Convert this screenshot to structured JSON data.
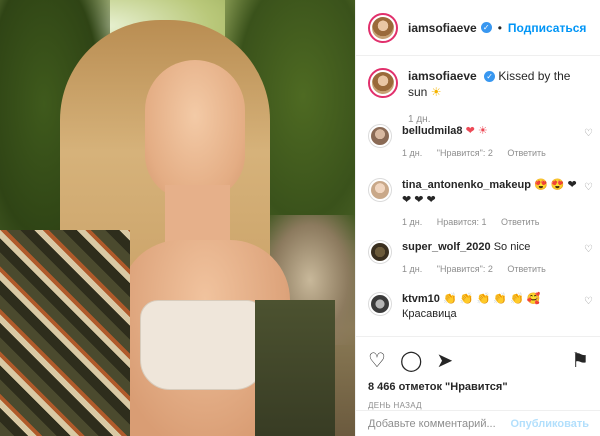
{
  "post": {
    "username": "iamsofiaeve",
    "follow_label": "Подписаться",
    "dot": "•",
    "verified_icon": "verified-badge-icon"
  },
  "caption": {
    "username": "iamsofiaeve",
    "text": "Kissed by the sun",
    "emoji": "☀",
    "time": "1 дн."
  },
  "comments": [
    {
      "username": "belludmila8",
      "text": "",
      "emojis": "❤ ☀",
      "time": "1 дн.",
      "likes": "\"Нравится\": 2",
      "reply": "Ответить"
    },
    {
      "username": "tina_antonenko_makeup",
      "text": "😍 😍",
      "emojis": "😍 😍 ❤ ❤ ❤ ❤",
      "time": "1 дн.",
      "likes": "Нравится: 1",
      "reply": "Ответить"
    },
    {
      "username": "super_wolf_2020",
      "text": "So nice",
      "emojis": "",
      "time": "1 дн.",
      "likes": "\"Нравится\": 2",
      "reply": "Ответить"
    },
    {
      "username": "ktvm10",
      "text": "Красавица",
      "emojis": "👏 👏 👏 👏 👏 🥰",
      "time": "",
      "likes": "",
      "reply": ""
    }
  ],
  "actions": {
    "likes": "8 466 отметок \"Нравится\"",
    "date": "ДЕНЬ НАЗАД"
  },
  "add_comment": {
    "placeholder": "Добавьте комментарий...",
    "publish": "Опубликовать"
  },
  "colors": {
    "accent": "#0095f6",
    "verified": "#3897f0",
    "muted": "#8e8e8e",
    "heart": "#ed4956"
  }
}
